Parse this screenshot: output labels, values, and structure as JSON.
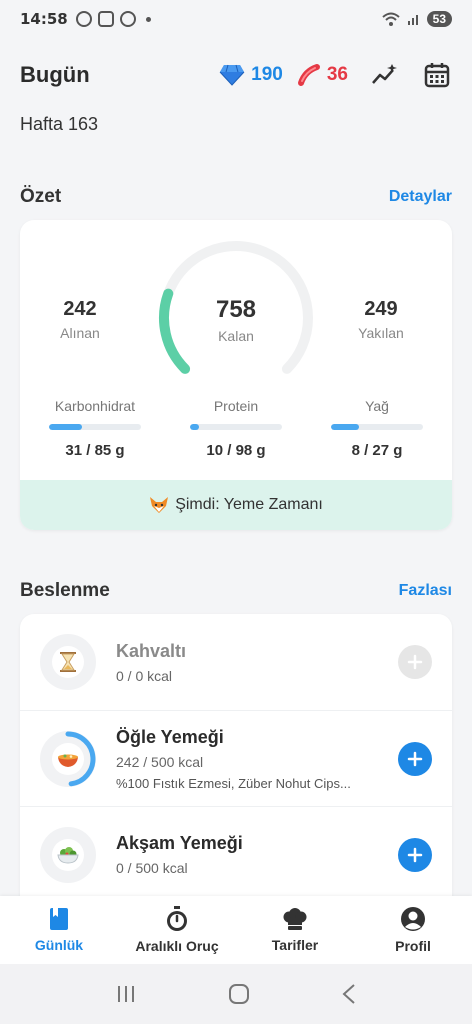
{
  "status_bar": {
    "time": "14:58",
    "battery": "53"
  },
  "header": {
    "title": "Bugün",
    "gems": "190",
    "streak": "36"
  },
  "week_label": "Hafta 163",
  "summary": {
    "section_title": "Özet",
    "details_link": "Detaylar",
    "eaten": {
      "value": "242",
      "label": "Alınan"
    },
    "remaining": {
      "value": "758",
      "label": "Kalan"
    },
    "burned": {
      "value": "249",
      "label": "Yakılan"
    },
    "ring_progress": 0.24,
    "macros": [
      {
        "label": "Karbonhidrat",
        "value": "31 / 85 g",
        "progress": 0.36
      },
      {
        "label": "Protein",
        "value": "10 / 98 g",
        "progress": 0.1
      },
      {
        "label": "Yağ",
        "value": "8 / 27 g",
        "progress": 0.3
      }
    ],
    "now_banner": "Şimdi: Yeme Zamanı"
  },
  "nutrition": {
    "section_title": "Beslenme",
    "more_link": "Fazlası",
    "meals": [
      {
        "name": "Kahvaltı",
        "kcal": "0 / 0 kcal",
        "desc": "",
        "progress": 0,
        "icon": "hourglass-icon"
      },
      {
        "name": "Öğle Yemeği",
        "kcal": "242 / 500 kcal",
        "desc": "%100 Fıstık Ezmesi, Züber Nohut  Cips...",
        "progress": 0.48,
        "icon": "curry-bowl-icon"
      },
      {
        "name": "Akşam Yemeği",
        "kcal": "0 / 500 kcal",
        "desc": "",
        "progress": 0,
        "icon": "salad-icon"
      }
    ]
  },
  "bottom_nav": [
    {
      "label": "Günlük",
      "active": true
    },
    {
      "label": "Aralıklı Oruç",
      "active": false
    },
    {
      "label": "Tarifler",
      "active": false
    },
    {
      "label": "Profil",
      "active": false
    }
  ],
  "colors": {
    "accent": "#1e88e5",
    "ring": "#5ccfa6",
    "streak": "#e53945",
    "banner": "#dcf3ec"
  }
}
